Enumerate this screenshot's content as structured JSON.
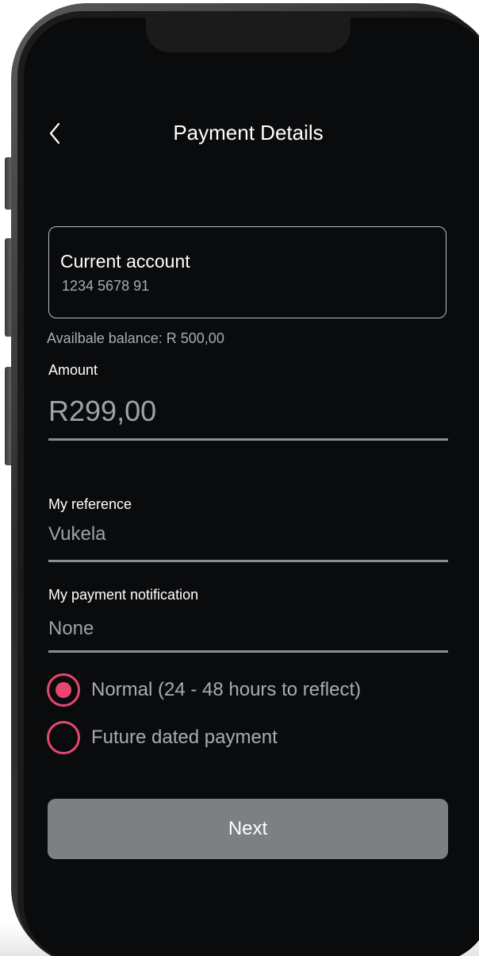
{
  "header": {
    "title": "Payment Details",
    "back_icon": "chevron-left-icon"
  },
  "account": {
    "name": "Current account",
    "number": "1234 5678 91"
  },
  "balance": {
    "text": "Availbale balance: R 500,00"
  },
  "amount": {
    "label": "Amount",
    "value": "R299,00"
  },
  "reference": {
    "label": "My reference",
    "value": "Vukela"
  },
  "notification": {
    "label": "My payment notification",
    "value": "None"
  },
  "payment_type": {
    "options": [
      {
        "label": "Normal (24 - 48 hours to reflect)",
        "selected": true
      },
      {
        "label": "Future dated payment",
        "selected": false
      }
    ]
  },
  "actions": {
    "next_label": "Next"
  },
  "colors": {
    "accent": "#e8466d",
    "screen_background": "#0a0b0d",
    "button": "#7d8083"
  }
}
